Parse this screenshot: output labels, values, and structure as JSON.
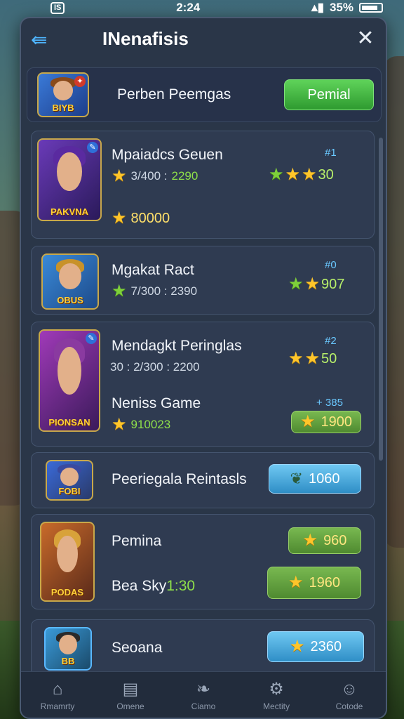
{
  "status": {
    "time": "2:24",
    "battery": "35%",
    "badge": "IS"
  },
  "header": {
    "title": "INenafisis"
  },
  "top_item": {
    "name": "Perben Peemgas",
    "thumb_label": "BIYB",
    "button": "Pemial"
  },
  "items": [
    {
      "name": "Mpaiadcs Geuen",
      "meta1_prefix": "3/400 :",
      "meta1_value": "2290",
      "rating_value": "30",
      "tag": "#1",
      "meta2": "80000",
      "thumb_label": "PAKVNA"
    },
    {
      "name": "Mgakat Ract",
      "meta1": "7/300 : 2390",
      "rating_value": "907",
      "tag": "#0",
      "thumb_label": "OBUS"
    },
    {
      "name": "Mendagkt Peringlas",
      "meta1": "30 : 2/300 : 2200",
      "rating_value": "50",
      "tag": "#2",
      "sub_name": "Neniss Game",
      "meta2": "910023",
      "sub_tag": "+ 385",
      "button": "1900",
      "thumb_label": "PIONSAN"
    },
    {
      "name": "Peeriegala Reintasls",
      "button": "1060",
      "thumb_label": "FOBI"
    },
    {
      "name": "Pemina",
      "sub_name": "Bea Sky",
      "sub_value": "1:30",
      "button1": "960",
      "button2": "1960",
      "thumb_label": "PODAS"
    },
    {
      "name": "Seoana",
      "button": "2360",
      "thumb_label": "BB"
    }
  ],
  "nav": [
    {
      "label": "Rmamrty",
      "icon": "home-icon"
    },
    {
      "label": "Omene",
      "icon": "panel-icon"
    },
    {
      "label": "Ciamo",
      "icon": "leaf-icon"
    },
    {
      "label": "Mectity",
      "icon": "gear-icon"
    },
    {
      "label": "Cotode",
      "icon": "person-icon"
    }
  ]
}
